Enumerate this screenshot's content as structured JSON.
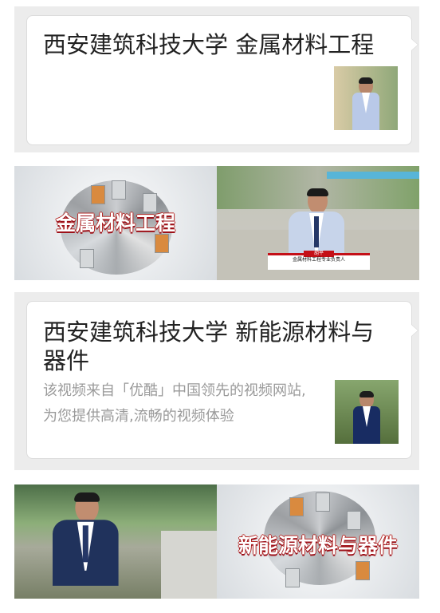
{
  "feed": {
    "items": [
      {
        "title": "西安建筑科技大学 金属材料工程",
        "thumbnail": "teacher-thumbnail"
      },
      {
        "banner_title": "金属材料工程",
        "caption_name": "胡平",
        "caption_role": "金属材料工程专业负责人"
      },
      {
        "title": "西安建筑科技大学 新能源材料与器件",
        "description": "该视频来自「优酷」中国领先的视频网站,为您提供高清,流畅的视频体验",
        "thumbnail": "teacher-thumbnail"
      },
      {
        "banner_title": "新能源材料与器件"
      }
    ]
  }
}
